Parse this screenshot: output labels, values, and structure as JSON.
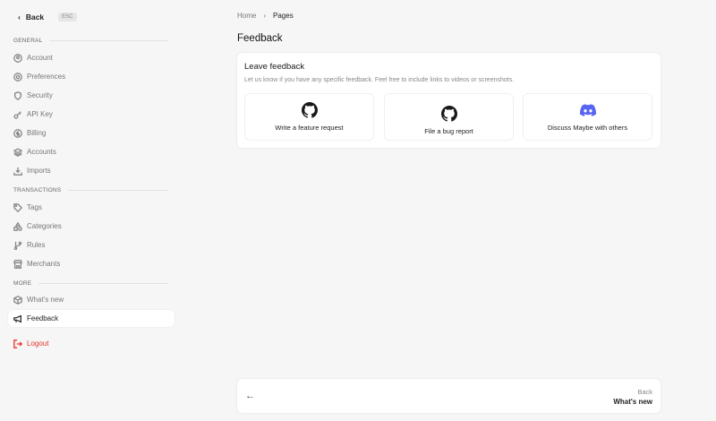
{
  "sidebar": {
    "back_label": "Back",
    "esc_label": "ESC",
    "sections": [
      "GENERAL",
      "TRANSACTIONS",
      "MORE"
    ],
    "general": [
      "Account",
      "Preferences",
      "Security",
      "API Key",
      "Billing",
      "Accounts",
      "Imports"
    ],
    "transactions": [
      "Tags",
      "Categories",
      "Rules",
      "Merchants"
    ],
    "more": [
      "What's new",
      "Feedback"
    ],
    "logout": "Logout"
  },
  "breadcrumb": [
    "Home",
    "Pages"
  ],
  "page_title": "Feedback",
  "card": {
    "title": "Leave feedback",
    "description": "Let us know if you have any specific feedback. Feel free to include links to videos or screenshots.",
    "options": [
      "Write a feature request",
      "File a bug report",
      "Discuss Maybe with others"
    ]
  },
  "pager": {
    "label": "Back",
    "title": "What's new"
  },
  "colors": {
    "discord": "#5865f2",
    "logout": "#e5322d"
  }
}
